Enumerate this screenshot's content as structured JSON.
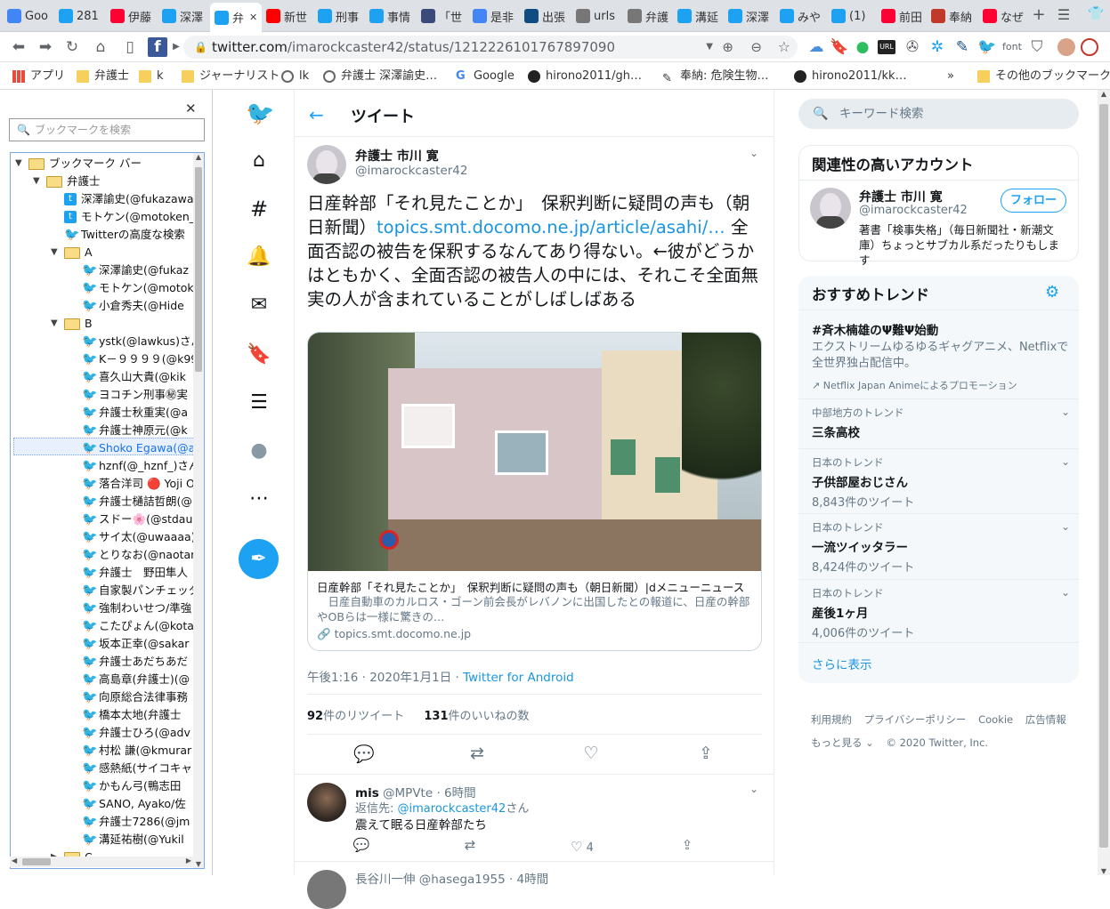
{
  "tabs": [
    {
      "label": "Goo",
      "icon": "google-docs-icon",
      "color": "#4285f4"
    },
    {
      "label": "281",
      "icon": "twitter-icon",
      "color": "#1da1f2"
    },
    {
      "label": "伊藤",
      "icon": "yahoo-icon",
      "color": "#ff0033"
    },
    {
      "label": "深澤",
      "icon": "twitter-icon",
      "color": "#1da1f2"
    },
    {
      "label": "弁",
      "icon": "twitter-icon",
      "color": "#1da1f2"
    },
    {
      "label": "新世",
      "icon": "youtube-icon",
      "color": "#ff0000"
    },
    {
      "label": "刑事",
      "icon": "twitter-icon",
      "color": "#1da1f2"
    },
    {
      "label": "事情",
      "icon": "twitter-icon",
      "color": "#1da1f2"
    },
    {
      "label": "「世",
      "icon": "gov-icon",
      "color": "#3a4a7a"
    },
    {
      "label": "是非",
      "icon": "google-icon",
      "color": "#4285f4"
    },
    {
      "label": "出張",
      "icon": "ns-icon",
      "color": "#0f4c81"
    },
    {
      "label": "urls",
      "icon": "globe-icon",
      "color": "#777777"
    },
    {
      "label": "弁護",
      "icon": "globe-icon",
      "color": "#777777"
    },
    {
      "label": "溝延",
      "icon": "twitter-icon",
      "color": "#1da1f2"
    },
    {
      "label": "深澤",
      "icon": "twitter-icon",
      "color": "#1da1f2"
    },
    {
      "label": "みや",
      "icon": "twitter-icon",
      "color": "#1da1f2"
    },
    {
      "label": "(1) ",
      "icon": "twitter-icon",
      "color": "#1da1f2"
    },
    {
      "label": "前田",
      "icon": "yahoo-icon",
      "color": "#ff0033"
    },
    {
      "label": "奉納",
      "icon": "sketch-icon",
      "color": "#c0392b"
    },
    {
      "label": "なぜ",
      "icon": "yahoo-icon",
      "color": "#ff0033"
    }
  ],
  "address": {
    "host": "twitter.com",
    "path": "/imarockcaster42/status/1212226101767897090"
  },
  "bookmarks_bar": [
    {
      "label": "アプリ",
      "icon": "apps-icon"
    },
    {
      "label": "弁護士",
      "icon": "folder-icon"
    },
    {
      "label": "k",
      "icon": "folder-icon"
    },
    {
      "label": "ジャーナリスト",
      "icon": "folder-icon"
    },
    {
      "label": "lk",
      "icon": "globe-icon"
    },
    {
      "label": "弁護士 深澤諭史…",
      "icon": "globe-icon"
    },
    {
      "label": "Google",
      "icon": "google-icon"
    },
    {
      "label": "hirono2011/gh…",
      "icon": "github-icon"
    },
    {
      "label": "奉納: 危険生物…",
      "icon": "sketch-icon"
    },
    {
      "label": "hirono2011/kk…",
      "icon": "github-icon"
    },
    {
      "label": "»",
      "icon": ""
    },
    {
      "label": "その他のブックマーク",
      "icon": "folder-icon"
    }
  ],
  "bm_panel": {
    "search_placeholder": "ブックマークを検索",
    "tree": [
      {
        "label": "ブックマーク バー",
        "type": "folder",
        "level": 0,
        "arrow": "▼"
      },
      {
        "label": "弁護士",
        "type": "folder",
        "level": 1,
        "arrow": "▼"
      },
      {
        "label": "深澤諭史(@fukazawa",
        "type": "tb",
        "level": 2
      },
      {
        "label": "モトケン(@motoken_",
        "type": "tb",
        "level": 2
      },
      {
        "label": "Twitterの高度な検索",
        "type": "tw",
        "level": 2
      },
      {
        "label": "A",
        "type": "folder",
        "level": 2,
        "arrow": "▼"
      },
      {
        "label": "深澤諭史(@fukaz",
        "type": "tw",
        "level": 3
      },
      {
        "label": "モトケン(@motok",
        "type": "tw",
        "level": 3
      },
      {
        "label": "小倉秀夫(@Hide",
        "type": "tw",
        "level": 3
      },
      {
        "label": "B",
        "type": "folder",
        "level": 2,
        "arrow": "▼"
      },
      {
        "label": "ystk(@lawkus)さん",
        "type": "tw",
        "level": 3
      },
      {
        "label": "K－９９９９(@k99",
        "type": "tw",
        "level": 3
      },
      {
        "label": "喜久山大貴(@kik",
        "type": "tw",
        "level": 3
      },
      {
        "label": "ヨコチン刑事㊙実",
        "type": "tw",
        "level": 3
      },
      {
        "label": "弁護士秋重実(@a",
        "type": "tw",
        "level": 3
      },
      {
        "label": "弁護士神原元(@k",
        "type": "tw",
        "level": 3
      },
      {
        "label": "Shoko Egawa(@a",
        "type": "tw",
        "level": 3,
        "selected": true
      },
      {
        "label": "hznf(@_hznf_)さん",
        "type": "tw",
        "level": 3
      },
      {
        "label": "落合洋司 🔴 Yoji O",
        "type": "tw",
        "level": 3
      },
      {
        "label": "弁護士樋詰哲朗(@",
        "type": "tw",
        "level": 3
      },
      {
        "label": "スドー🌸(@stdau",
        "type": "tw",
        "level": 3
      },
      {
        "label": "サイ太(@uwaaaa)",
        "type": "tw",
        "level": 3
      },
      {
        "label": "とりなお(@naotar",
        "type": "tw",
        "level": 3
      },
      {
        "label": "弁護士　野田隼人",
        "type": "tw",
        "level": 3
      },
      {
        "label": "自家製パンチェッタ",
        "type": "tw",
        "level": 3
      },
      {
        "label": "強制わいせつ/準強",
        "type": "tw",
        "level": 3
      },
      {
        "label": "こたぴょん(@kota",
        "type": "tw",
        "level": 3
      },
      {
        "label": "坂本正幸(@sakar",
        "type": "tw",
        "level": 3
      },
      {
        "label": "弁護士あだちあだ",
        "type": "tw",
        "level": 3
      },
      {
        "label": "高島章(弁護士)(@",
        "type": "tw",
        "level": 3
      },
      {
        "label": "向原総合法律事務",
        "type": "tw",
        "level": 3
      },
      {
        "label": "橋本太地(弁護士",
        "type": "tw",
        "level": 3
      },
      {
        "label": "弁護士ひろ(@adv",
        "type": "tw",
        "level": 3
      },
      {
        "label": "村松 謙(@kmurar",
        "type": "tw",
        "level": 3
      },
      {
        "label": "感熱紙(サイコキャ",
        "type": "tw",
        "level": 3
      },
      {
        "label": "かもん弓(鴨志田",
        "type": "tw",
        "level": 3
      },
      {
        "label": "SANO, Ayako/佐",
        "type": "tw",
        "level": 3
      },
      {
        "label": "弁護士7286(@jm",
        "type": "tw",
        "level": 3
      },
      {
        "label": "溝延祐樹(@Yukil",
        "type": "tw",
        "level": 3
      },
      {
        "label": "C",
        "type": "folder",
        "level": 2,
        "arrow": "▶"
      }
    ]
  },
  "twitter": {
    "header_title": "ツイート",
    "tweet": {
      "author_name": "弁護士 市川 寛",
      "author_handle": "@imarockcaster42",
      "text_before_link": "日産幹部「それ見たことか」　保釈判断に疑問の声も（朝日新聞）",
      "link": "topics.smt.docomo.ne.jp/article/asahi/…",
      "text_after_link": " 全面否認の被告を保釈するなんてあり得ない。←彼がどうかはともかく、全面否認の被告人の中には、それこそ全面無実の人が含まれていることがしばしばある",
      "card_title": "日産幹部「それ見たことか」　保釈判断に疑問の声も（朝日新聞）|dメニューニュース",
      "card_desc": "　日産自動車のカルロス・ゴーン前会長がレバノンに出国したとの報道に、日産の幹部やOBらは一様に驚きの…",
      "card_domain": "topics.smt.docomo.ne.jp",
      "timestamp": "午後1:16 · 2020年1月1日 · ",
      "source": "Twitter for Android",
      "retweets_count": "92",
      "retweets_label": "件のリツイート",
      "likes_count": "131",
      "likes_label": "件のいいねの数"
    },
    "reply": {
      "name": "mis",
      "handle": "@MPVte",
      "time": " · 6時間",
      "reply_to_label": "返信先: ",
      "reply_to_handle": "@imarockcaster42",
      "reply_to_suffix": "さん",
      "text": "震えて眠る日産幹部たち",
      "likes": "4"
    },
    "next_reply_peek": "長谷川一伸 @hasega1955 · 4時間",
    "search_placeholder": "キーワード検索",
    "related": {
      "title": "関連性の高いアカウント",
      "name": "弁護士 市川 寛",
      "handle": "@imarockcaster42",
      "follow_label": "フォロー",
      "bio": "著書「検事失格」（毎日新聞社・新潮文庫）ちょっとサブカル系だったりもします"
    },
    "trends": {
      "title": "おすすめトレンド",
      "promo": {
        "tag": "#斉木楠雄のΨ難Ψ始動",
        "desc": "エクストリームゆるゆるギャグアニメ、Netflixで全世界独占配信中。",
        "by": "Netflix Japan Animeによるプロモーション"
      },
      "items": [
        {
          "context": "中部地方のトレンド",
          "name": "三条高校",
          "count": ""
        },
        {
          "context": "日本のトレンド",
          "name": "子供部屋おじさん",
          "count": "8,843件のツイート"
        },
        {
          "context": "日本のトレンド",
          "name": "一流ツイッタラー",
          "count": "8,424件のツイート"
        },
        {
          "context": "日本のトレンド",
          "name": "産後1ヶ月",
          "count": "4,006件のツイート"
        }
      ],
      "show_more": "さらに表示"
    },
    "footer": {
      "links": [
        "利用規約",
        "プライバシーポリシー",
        "Cookie",
        "広告情報"
      ],
      "more": "もっと見る",
      "copyright": "© 2020 Twitter, Inc."
    }
  },
  "colors": {
    "twitter_blue": "#1da1f2",
    "text": "#14171a",
    "muted": "#657786"
  }
}
